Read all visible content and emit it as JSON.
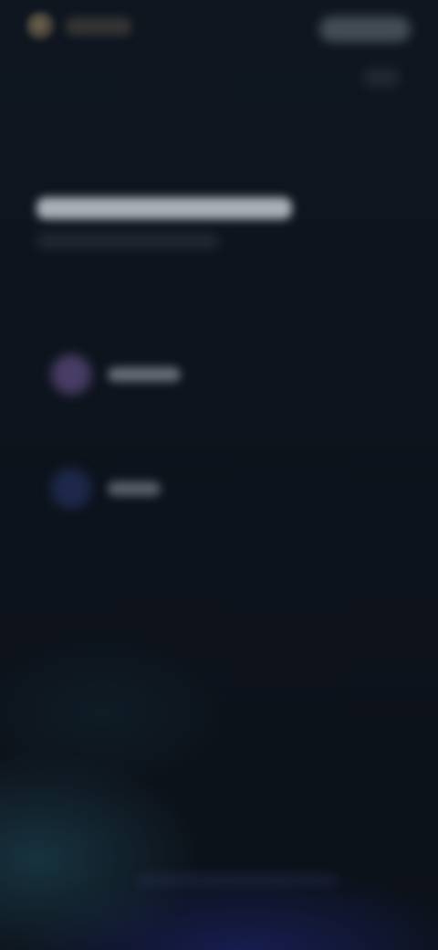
{
  "app": {
    "name": ""
  },
  "header": {
    "action_label": "",
    "secondary_action_label": ""
  },
  "main": {
    "title": "",
    "subtitle": "",
    "options": [
      {
        "label": "",
        "icon": "avatar-icon"
      },
      {
        "label": "",
        "icon": "avatar-icon"
      }
    ]
  },
  "theme": {
    "background": "#0d131d",
    "bottom_glow_teal": "#204e5c",
    "bottom_glow_indigo": "#1c246e",
    "option1_icon_color": "#785fa0",
    "option2_icon_color": "#283769"
  }
}
